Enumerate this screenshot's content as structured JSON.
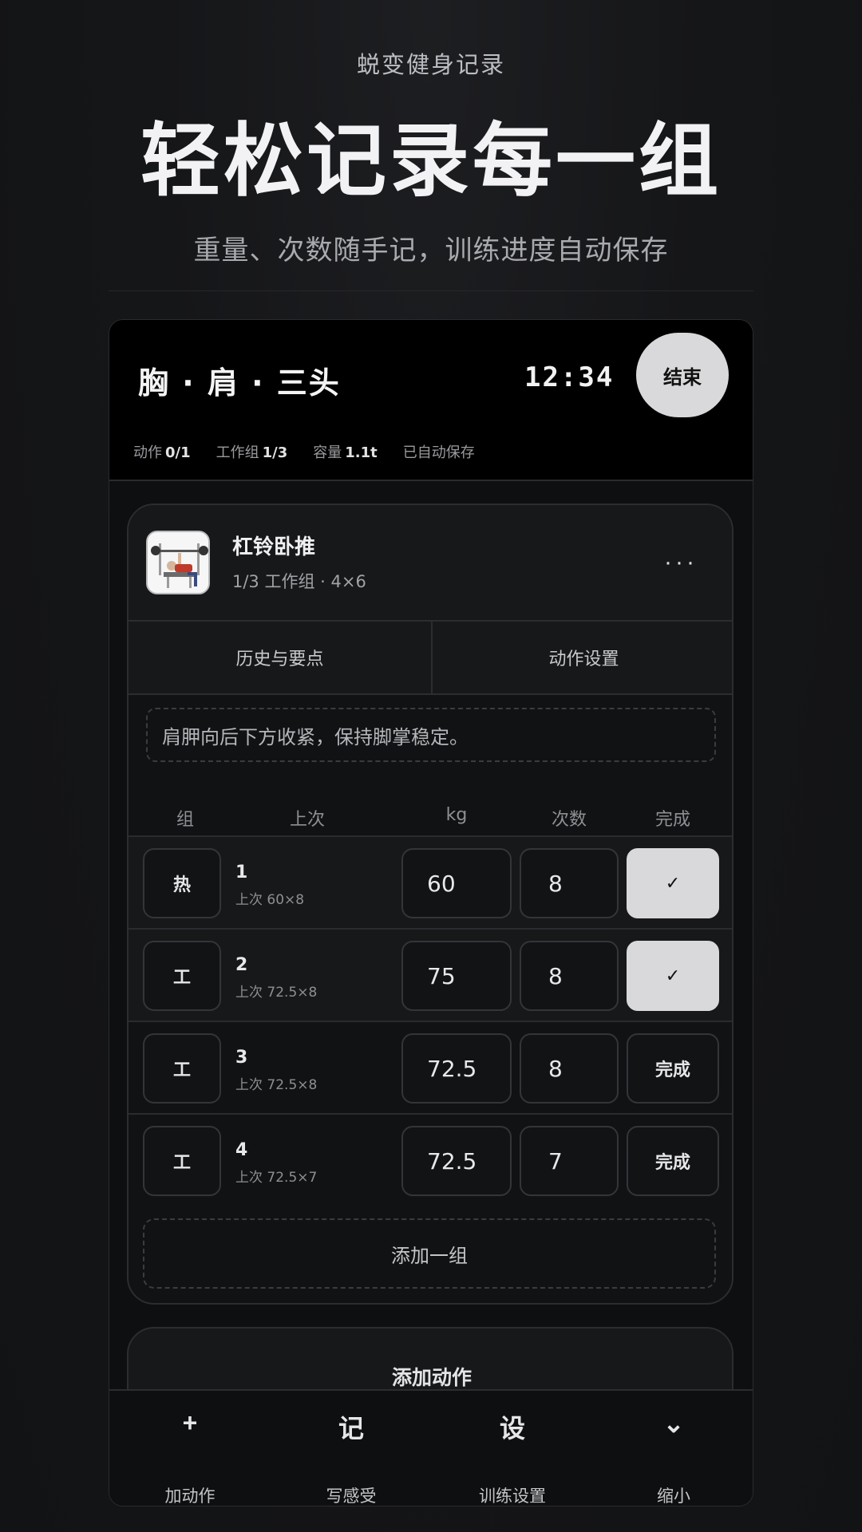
{
  "hero": {
    "brand": "蜕变健身记录",
    "headline": "轻松记录每一组",
    "subtitle": "重量、次数随手记，训练进度自动保存"
  },
  "workout": {
    "title": "胸 · 肩 · 三头",
    "timer": "12:34",
    "end_label": "结束",
    "stats": {
      "exercises_label": "动作",
      "exercises_value": "0/1",
      "work_sets_label": "工作组",
      "work_sets_value": "1/3",
      "volume_label": "容量",
      "volume_value": "1.1t",
      "autosave": "已自动保存"
    }
  },
  "exercise": {
    "thumb_icon": "bench-press-illustration",
    "name": "杠铃卧推",
    "meta": "1/3 工作组 · 4×6",
    "more_icon": "more-horizontal-icon",
    "tabs": [
      "历史与要点",
      "动作设置"
    ],
    "note": "肩胛向后下方收紧，保持脚掌稳定。",
    "columns": {
      "set": "组",
      "last": "上次",
      "kg": "kg",
      "reps": "次数",
      "done": "完成"
    },
    "sets": [
      {
        "type": "热",
        "number": "1",
        "last": "上次 60×8",
        "kg": "60",
        "reps": "8",
        "done": "✓",
        "completed": true
      },
      {
        "type": "工",
        "number": "2",
        "last": "上次 72.5×8",
        "kg": "75",
        "reps": "8",
        "done": "✓",
        "completed": true
      },
      {
        "type": "工",
        "number": "3",
        "last": "上次 72.5×8",
        "kg": "72.5",
        "reps": "8",
        "done": "完成",
        "completed": false
      },
      {
        "type": "工",
        "number": "4",
        "last": "上次 72.5×7",
        "kg": "72.5",
        "reps": "7",
        "done": "完成",
        "completed": false
      }
    ],
    "add_set_label": "添加一组"
  },
  "add_exercise_label": "添加动作",
  "bottom_bar": [
    {
      "icon": "+",
      "label": "加动作"
    },
    {
      "icon": "记",
      "label": "写感受"
    },
    {
      "icon": "设",
      "label": "训练设置"
    },
    {
      "icon": "⌄",
      "label": "缩小"
    }
  ],
  "colors": {
    "background": "#141517",
    "panel": "#000000",
    "card": "#111214",
    "accent_button": "#d9d9dc"
  }
}
